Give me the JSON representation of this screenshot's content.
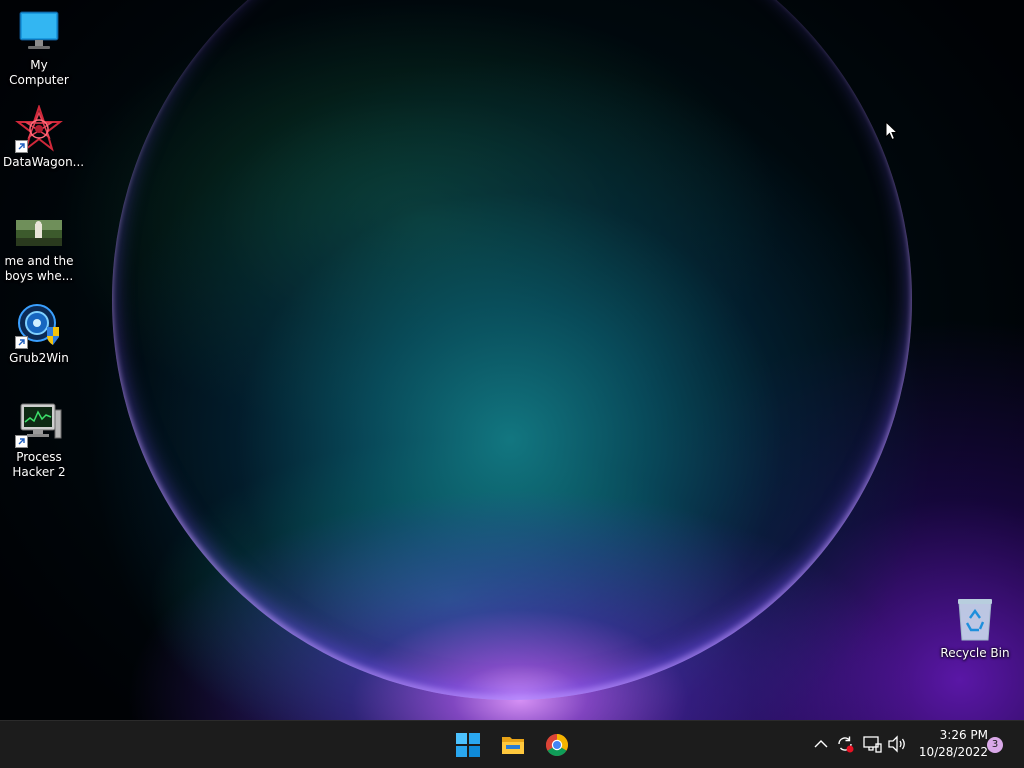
{
  "desktop": {
    "icons": [
      {
        "label": "My Computer",
        "icon": "monitor-icon",
        "shortcut": false
      },
      {
        "label": "DataWagon...",
        "icon": "datawagon-star-icon",
        "shortcut": true
      },
      {
        "label": "me and the boys whe...",
        "icon": "image-thumbnail-icon",
        "shortcut": false
      },
      {
        "label": "Grub2Win",
        "icon": "grub2win-shield-icon",
        "shortcut": true
      },
      {
        "label": "Process Hacker 2",
        "icon": "process-hacker-icon",
        "shortcut": true
      }
    ],
    "recycle_bin": {
      "label": "Recycle Bin",
      "icon": "recycle-bin-icon"
    }
  },
  "taskbar": {
    "apps": [
      {
        "name": "Start",
        "icon": "windows-start-icon"
      },
      {
        "name": "File Explorer",
        "icon": "file-explorer-icon"
      },
      {
        "name": "Google Chrome",
        "icon": "chrome-icon"
      }
    ],
    "tray": {
      "icons": [
        "chevron-up-icon",
        "sync-icon",
        "network-icon",
        "volume-icon"
      ],
      "time": "3:26 PM",
      "date": "10/28/2022",
      "notification_count": "3"
    }
  },
  "colors": {
    "taskbar_bg": "#1c1c1c",
    "accent_blue": "#0078d4",
    "badge": "#d9a8e8"
  }
}
